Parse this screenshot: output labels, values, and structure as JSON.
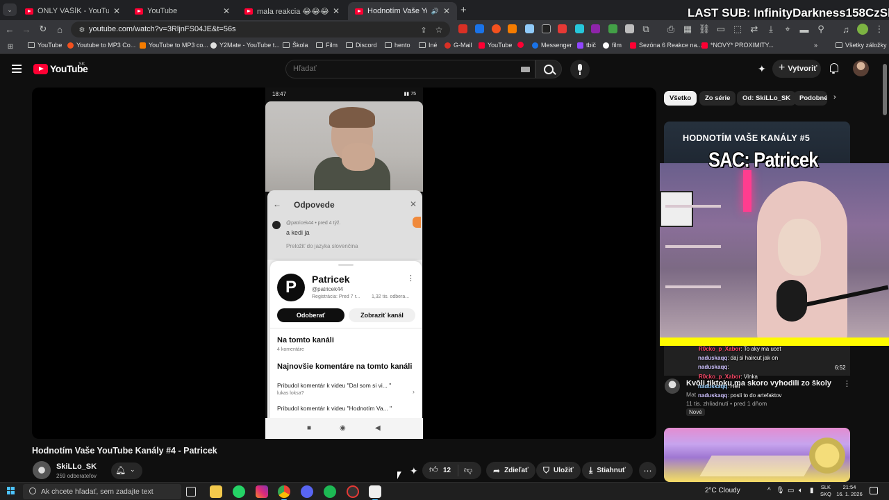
{
  "browser": {
    "tabs": [
      {
        "title": "ONLY VAŠÍK - YouTube",
        "active": false
      },
      {
        "title": "YouTube",
        "active": false
      },
      {
        "title": "mala reakcia 😂😂😂 - YouTu",
        "active": false
      },
      {
        "title": "Hodnotím Vaše YouTube Ka",
        "active": true
      }
    ],
    "url": "youtube.com/watch?v=3RljnFS04JE&t=56s",
    "bookmarks": [
      "YouTube",
      "Youtube to MP3 Co...",
      "YouTube to MP3 co...",
      "Y2Mate - YouTube t...",
      "Škola",
      "Film",
      "Discord",
      "hento",
      "Iné",
      "G-Mail",
      "YouTube",
      "Messenger",
      "tbič",
      "film",
      "Sezóna 6 Reakce na...",
      "*NOVÝ* PROXIMITY...",
      "Všetky záložky"
    ]
  },
  "stream_overlay": {
    "last_sub": "LAST SUB: InfinityDarkness158CzSk",
    "sac_title": "SAC: Patricek",
    "chat": [
      {
        "name": "R0cko_p_Xabor",
        "msg": ": To aky ma ucet"
      },
      {
        "name": "naduskaqq",
        "msg": ": daj si haircut jak on"
      },
      {
        "name": "naduskaqq",
        "msg": ":"
      },
      {
        "name": "R0cko_p_Xabor",
        "msg": ": Vlnka"
      },
      {
        "name": "naduskaqq",
        "msg": ": Hell"
      },
      {
        "name": "naduskaqq",
        "msg": ": posli to do artefaktov"
      }
    ]
  },
  "youtube": {
    "logo_text": "YouTube",
    "country": "SK",
    "search_placeholder": "Hľadať",
    "create_label": "Vytvoriť",
    "video": {
      "title": "Hodnotím Vaše YouTube Kanály #4 - Patricek",
      "channel": "SkiLLo_SK",
      "subscribers": "259 odberateľov",
      "likes": "12",
      "share_label": "Zdieľať",
      "save_label": "Uložiť",
      "download_label": "Stiahnuť"
    },
    "phone_screen": {
      "time": "18:47",
      "status_right": "▮▮ 75",
      "sheet_title": "Odpovede",
      "comment_handle": "@patricek44 • pred 4 týž.",
      "comment_text": "a kedi ja",
      "translate": "Preložiť do jazyka slovenčina",
      "card": {
        "logo_letter": "P",
        "name": "Patricek",
        "handle": "@patricek44",
        "registration": "Registrácia: Pred 7 r...",
        "subs": "1,32 tis. odbera...",
        "subscribe": "Odoberať",
        "view_channel": "Zobraziť kanál",
        "section1": "Na tomto kanáli",
        "section1_sub": "4 komentáre",
        "section2": "Najnovšie komentáre na tomto kanáli",
        "row1": "Pribudol komentár k videu \"Dal som si vi... \"",
        "row1_sub": "lukas loksa?",
        "row2": "Pribudol komentár k videu \"Hodnotím Va... \""
      }
    },
    "chips": [
      "Všetko",
      "Zo série",
      "Od: SkiLLo_SK",
      "Podobné"
    ],
    "related": [
      {
        "thumb_title": "HODNOTÍM VAŠE KANÁLY #5",
        "duration": "6:52",
        "title": "Kvôli tiktoku ma skoro vyhodili zo školy",
        "channel": "Mat",
        "meta": "11 tis. zhliadnutí • pred 1 dňom",
        "badge": "Nové"
      }
    ]
  },
  "taskbar": {
    "search_placeholder": "Ak chcete hľadať, sem zadajte text",
    "weather": "2°C  Cloudy",
    "lang1": "SLK",
    "lang2": "SKQ",
    "time": "21:54",
    "date": "16. 1. 2026"
  },
  "colors": {
    "youtube_red": "#ff0033",
    "background": "#0f0f0f",
    "chip_bg": "#272727",
    "overlay_yellow": "#fffb00"
  }
}
